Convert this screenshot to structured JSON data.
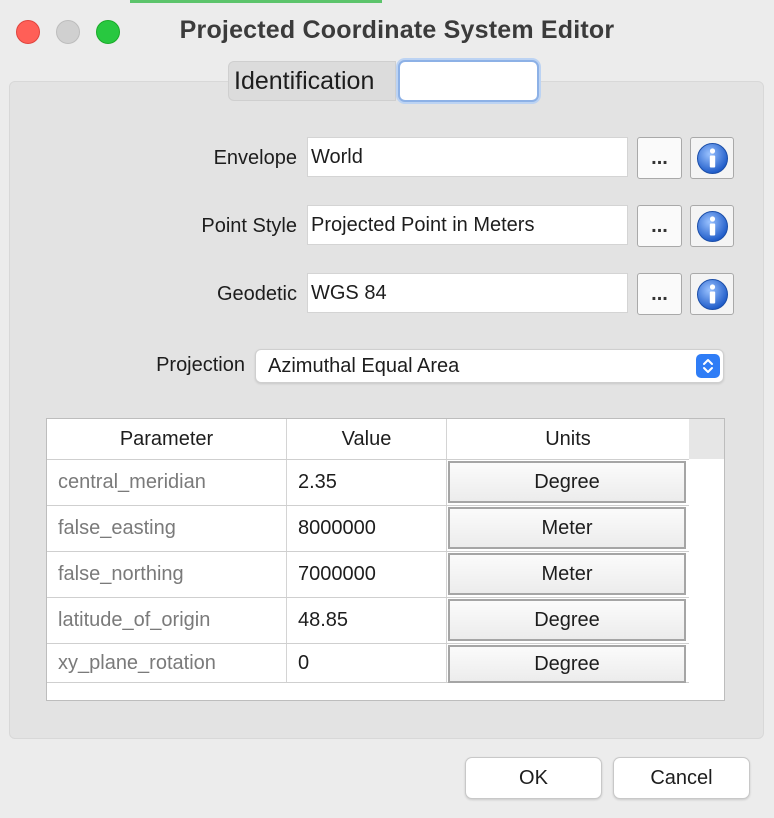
{
  "window": {
    "title": "Projected Coordinate System Editor"
  },
  "identification": {
    "label": "Identification",
    "value": ""
  },
  "fields": [
    {
      "label": "Envelope",
      "value": "World",
      "more": "..."
    },
    {
      "label": "Point Style",
      "value": "Projected Point in Meters",
      "more": "..."
    },
    {
      "label": "Geodetic",
      "value": "WGS 84",
      "more": "..."
    }
  ],
  "projection": {
    "label": "Projection",
    "selected": "Azimuthal Equal Area"
  },
  "table": {
    "headers": [
      "Parameter",
      "Value",
      "Units"
    ],
    "rows": [
      {
        "parameter": "central_meridian",
        "value": "2.35",
        "units": "Degree"
      },
      {
        "parameter": "false_easting",
        "value": "8000000",
        "units": "Meter"
      },
      {
        "parameter": "false_northing",
        "value": "7000000",
        "units": "Meter"
      },
      {
        "parameter": "latitude_of_origin",
        "value": "48.85",
        "units": "Degree"
      },
      {
        "parameter": "xy_plane_rotation",
        "value": "0",
        "units": "Degree"
      }
    ]
  },
  "buttons": {
    "ok": "OK",
    "cancel": "Cancel"
  },
  "colors": {
    "accent": "#2f7df6",
    "close": "#ff5f57",
    "maximize": "#28c840"
  }
}
